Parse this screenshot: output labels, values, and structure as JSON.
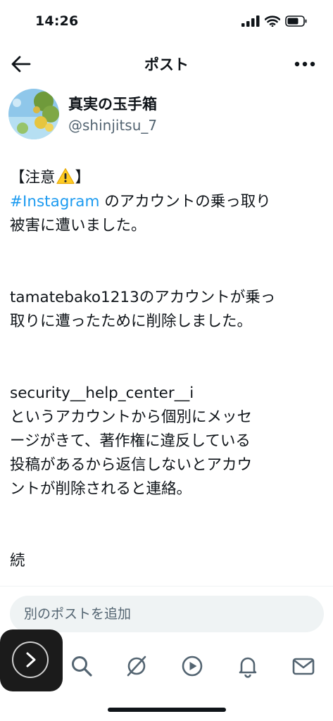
{
  "status_bar": {
    "time": "14:26"
  },
  "header": {
    "title": "ポスト"
  },
  "author": {
    "display_name": "真実の玉手箱",
    "handle": "@shinjitsu_7"
  },
  "post": {
    "line1_before": "【注意",
    "line1_after": "】",
    "hashtag": "#Instagram",
    "line2_after": " のアカウントの乗っ取り",
    "line3": "被害に遭いました。",
    "para2_line1": "tamatebako1213のアカウントが乗っ",
    "para2_line2": "取りに遭ったために削除しました。",
    "para3_line1": "security__help_center__i",
    "para3_line2": "というアカウントから個別にメッセ",
    "para3_line3": "ージがきて、著作権に違反している",
    "para3_line4": "投稿があるから返信しないとアカウ",
    "para3_line5": "ントが削除されると連絡。",
    "para4": "続"
  },
  "reply": {
    "placeholder": "別のポストを追加"
  },
  "tabbar": {
    "icons": [
      "home-icon",
      "search-icon",
      "grok-icon",
      "video-icon",
      "notifications-icon",
      "messages-icon"
    ]
  },
  "colors": {
    "link": "#1d9bf0",
    "text": "#0f1419",
    "secondary": "#536471",
    "input_bg": "#eff3f4"
  }
}
